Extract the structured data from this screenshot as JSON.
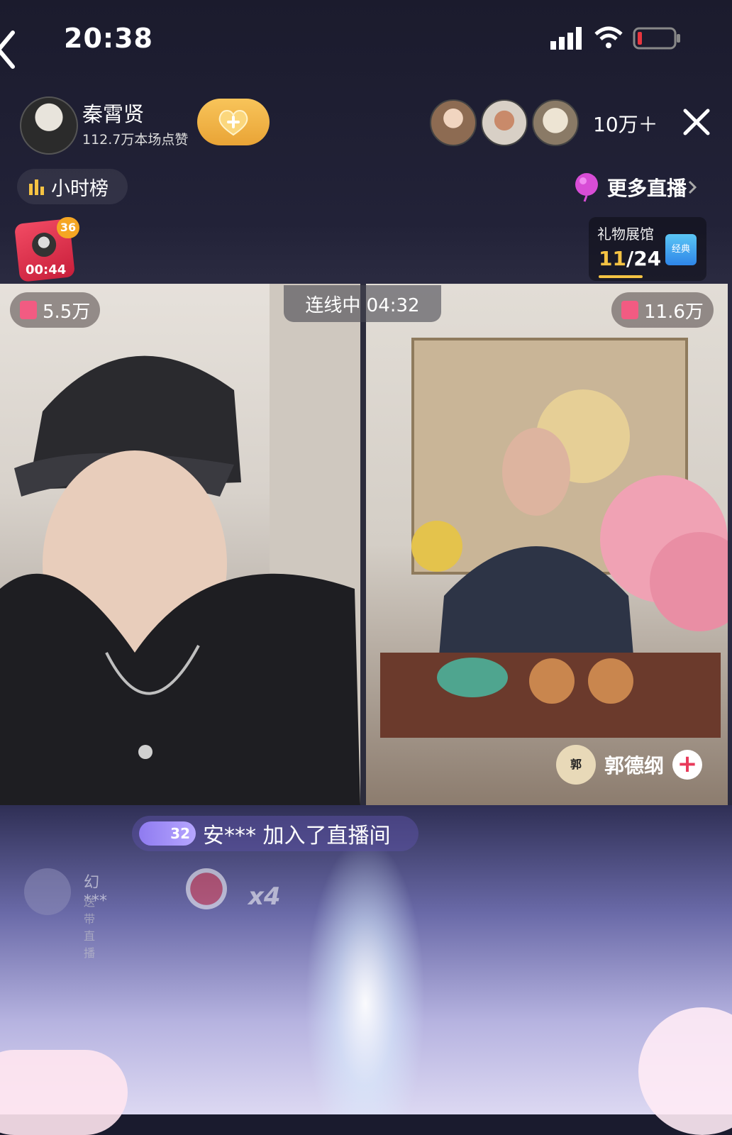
{
  "status": {
    "time": "20:38"
  },
  "host": {
    "name": "秦霄贤",
    "likes": "112.7万本场点赞"
  },
  "header": {
    "viewer_count": "10万＋"
  },
  "hour_rank": {
    "label": "小时榜"
  },
  "more_live": {
    "label": "更多直播"
  },
  "red_packet": {
    "badge": "36",
    "timer": "00:44"
  },
  "gift_hall": {
    "title": "礼物展馆",
    "current": "11",
    "total": "/24",
    "tag": "经典"
  },
  "pk": {
    "status": "连线中 04:32",
    "left_score": "5.5万",
    "right_score": "11.6万"
  },
  "guest": {
    "name": "郭德纲",
    "avatar_text": "郭"
  },
  "chat": {
    "join_level": "32",
    "join_text": "安*** 加入了直播间",
    "gift_user": "幻***",
    "gift_sub": "送带直播",
    "gift_count": "x4"
  },
  "colors": {
    "accent_gold": "#f5c343",
    "follow_gold": "#f0b245",
    "pk_pink": "#f25b82"
  }
}
